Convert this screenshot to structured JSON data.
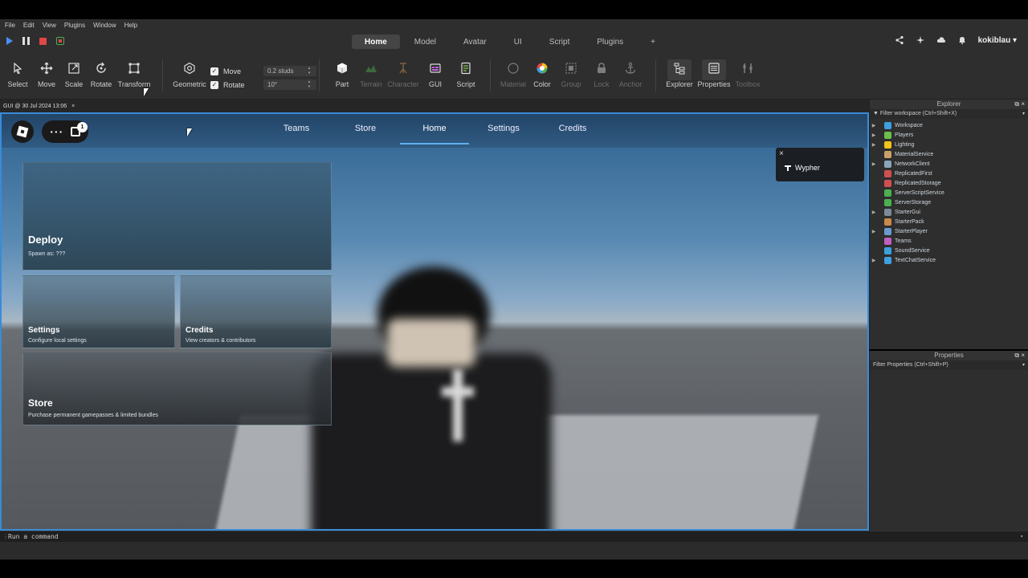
{
  "menu": [
    "File",
    "Edit",
    "View",
    "Plugins",
    "Window",
    "Help"
  ],
  "tabs": [
    {
      "label": "Home",
      "active": true
    },
    {
      "label": "Model"
    },
    {
      "label": "Avatar"
    },
    {
      "label": "UI"
    },
    {
      "label": "Script"
    },
    {
      "label": "Plugins"
    },
    {
      "label": "+"
    }
  ],
  "user": {
    "name": "kokiblau"
  },
  "tools": {
    "select": "Select",
    "move": "Move",
    "scale": "Scale",
    "rotate": "Rotate",
    "transform": "Transform",
    "geometric": "Geometric",
    "part": "Part",
    "terrain": "Terrain",
    "character": "Character",
    "gui": "GUI",
    "script": "Script",
    "material": "Material",
    "color": "Color",
    "group": "Group",
    "lock": "Lock",
    "anchor": "Anchor",
    "explorer": "Explorer",
    "properties": "Properties",
    "toolbox": "Toolbox"
  },
  "snap": {
    "move_label": "Move",
    "move_value": "0.2 studs",
    "rotate_label": "Rotate",
    "rotate_value": "10°"
  },
  "doc_tab": {
    "label": "GUI @ 30 Jul 2024 13:06",
    "close": "×"
  },
  "game": {
    "nav": [
      "Teams",
      "Store",
      "Home",
      "Settings",
      "Credits"
    ],
    "active_nav": "Home",
    "badge": "1",
    "toast": {
      "close": "×",
      "name": "Wypher"
    },
    "cards": {
      "deploy": {
        "title": "Deploy",
        "sub": "Spawn as: ???"
      },
      "settings": {
        "title": "Settings",
        "sub": "Configure local settings"
      },
      "credits": {
        "title": "Credits",
        "sub": "View creators & contributors"
      },
      "store": {
        "title": "Store",
        "sub": "Purchase permanent gamepasses & limited bundles"
      }
    }
  },
  "explorer": {
    "title": "Explorer",
    "filter": "Filter workspace (Ctrl+Shift+X)",
    "items": [
      {
        "label": "Workspace",
        "expandable": true,
        "color": "#3da0e0"
      },
      {
        "label": "Players",
        "expandable": true,
        "color": "#6bbf4a"
      },
      {
        "label": "Lighting",
        "expandable": true,
        "color": "#f0c419"
      },
      {
        "label": "MaterialService",
        "expandable": false,
        "color": "#c9a06a"
      },
      {
        "label": "NetworkClient",
        "expandable": true,
        "color": "#8aa4b8"
      },
      {
        "label": "ReplicatedFirst",
        "expandable": false,
        "color": "#d05050"
      },
      {
        "label": "ReplicatedStorage",
        "expandable": false,
        "color": "#d05050"
      },
      {
        "label": "ServerScriptService",
        "expandable": false,
        "color": "#4caf50"
      },
      {
        "label": "ServerStorage",
        "expandable": false,
        "color": "#4caf50"
      },
      {
        "label": "StarterGui",
        "expandable": true,
        "color": "#7a8a9a"
      },
      {
        "label": "StarterPack",
        "expandable": false,
        "color": "#c98a4a"
      },
      {
        "label": "StarterPlayer",
        "expandable": true,
        "color": "#6a9ad0"
      },
      {
        "label": "Teams",
        "expandable": false,
        "color": "#c060c0"
      },
      {
        "label": "SoundService",
        "expandable": false,
        "color": "#3da0e0"
      },
      {
        "label": "TextChatService",
        "expandable": true,
        "color": "#3da0e0"
      }
    ]
  },
  "properties": {
    "title": "Properties",
    "filter": "Filter Properties (Ctrl+Shift+P)"
  },
  "command": {
    "placeholder": "Run a command"
  }
}
